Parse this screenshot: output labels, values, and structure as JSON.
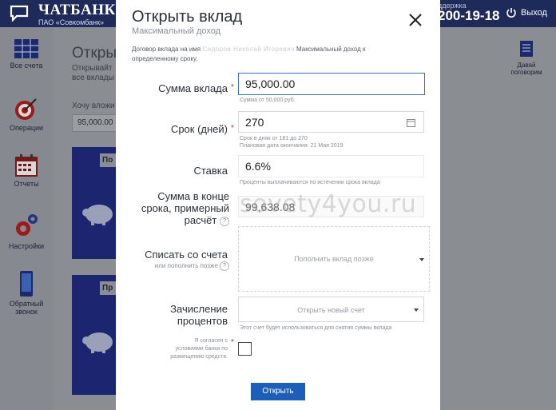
{
  "header": {
    "logo_title": "ЧАТБАНК",
    "logo_subtitle": "ПАО «Совкомбанк»",
    "support_label": "ддержка",
    "support_phone": "200-19-18",
    "logout_label": "Выход"
  },
  "sidebar": {
    "items": [
      {
        "label": "Все счета",
        "icon": "grid-table-icon"
      },
      {
        "label": "Операции",
        "icon": "target-icon"
      },
      {
        "label": "Отчеты",
        "icon": "calendar-icon"
      },
      {
        "label": "Настройки",
        "icon": "gears-icon"
      },
      {
        "label": "Обратный звонок",
        "icon": "phone-icon"
      }
    ]
  },
  "background": {
    "page_title": "Открыт",
    "page_sub_1": "Открывайт",
    "page_sub_2": "все вклады",
    "amount_label": "Хочу вложи",
    "amount_value": "95,000.00",
    "card_tab_1": "По",
    "card_tab_2": "Пр",
    "right_action_label": "Давай поговорим"
  },
  "modal": {
    "title": "Открыть вклад",
    "subtitle": "Максимальный доход",
    "contract_prefix": "Договор вклада на имя",
    "contract_name_blurred": "Сидоров Николай Игоревич",
    "contract_suffix": "Максимальный доход к определенному сроку.",
    "fields": {
      "amount": {
        "label": "Сумма вклада",
        "value": "95,000.00",
        "hint": "Сумма от 50,000 руб."
      },
      "term": {
        "label": "Срок (дней)",
        "value": "270",
        "hint_1": "Срок в днях от 181 до 270",
        "hint_2": "Плановая дата окончания: 21 Мая 2019"
      },
      "rate": {
        "label": "Ставка",
        "value": "6.6%",
        "hint": "Проценты выплачиваются по истечении срока вклада"
      },
      "total": {
        "label_1": "Сумма в конце",
        "label_2": "срока, примерный",
        "label_3": "расчёт",
        "help": "?",
        "value": "99,638.08"
      },
      "debit": {
        "label": "Списать со счета",
        "sublabel": "или пополнить позже",
        "help": "?",
        "placeholder": "Пополнить вклад позже"
      },
      "interest": {
        "label_1": "Зачисление",
        "label_2": "процентов",
        "placeholder": "Открыть новый счет",
        "hint": "Этот счет будет использоваться для снятия суммы вклада"
      }
    },
    "agreement": {
      "line_1": "Я согласен с",
      "line_2": "условиями банка по",
      "line_3": "размещению средств."
    },
    "submit_label": "Открыть",
    "watermark": "sovety4you.ru"
  },
  "colors": {
    "header_bg": "#1e2b5a",
    "accent_blue": "#1d5fb8",
    "card_bg": "#1c2670",
    "required": "#d02b2b"
  }
}
